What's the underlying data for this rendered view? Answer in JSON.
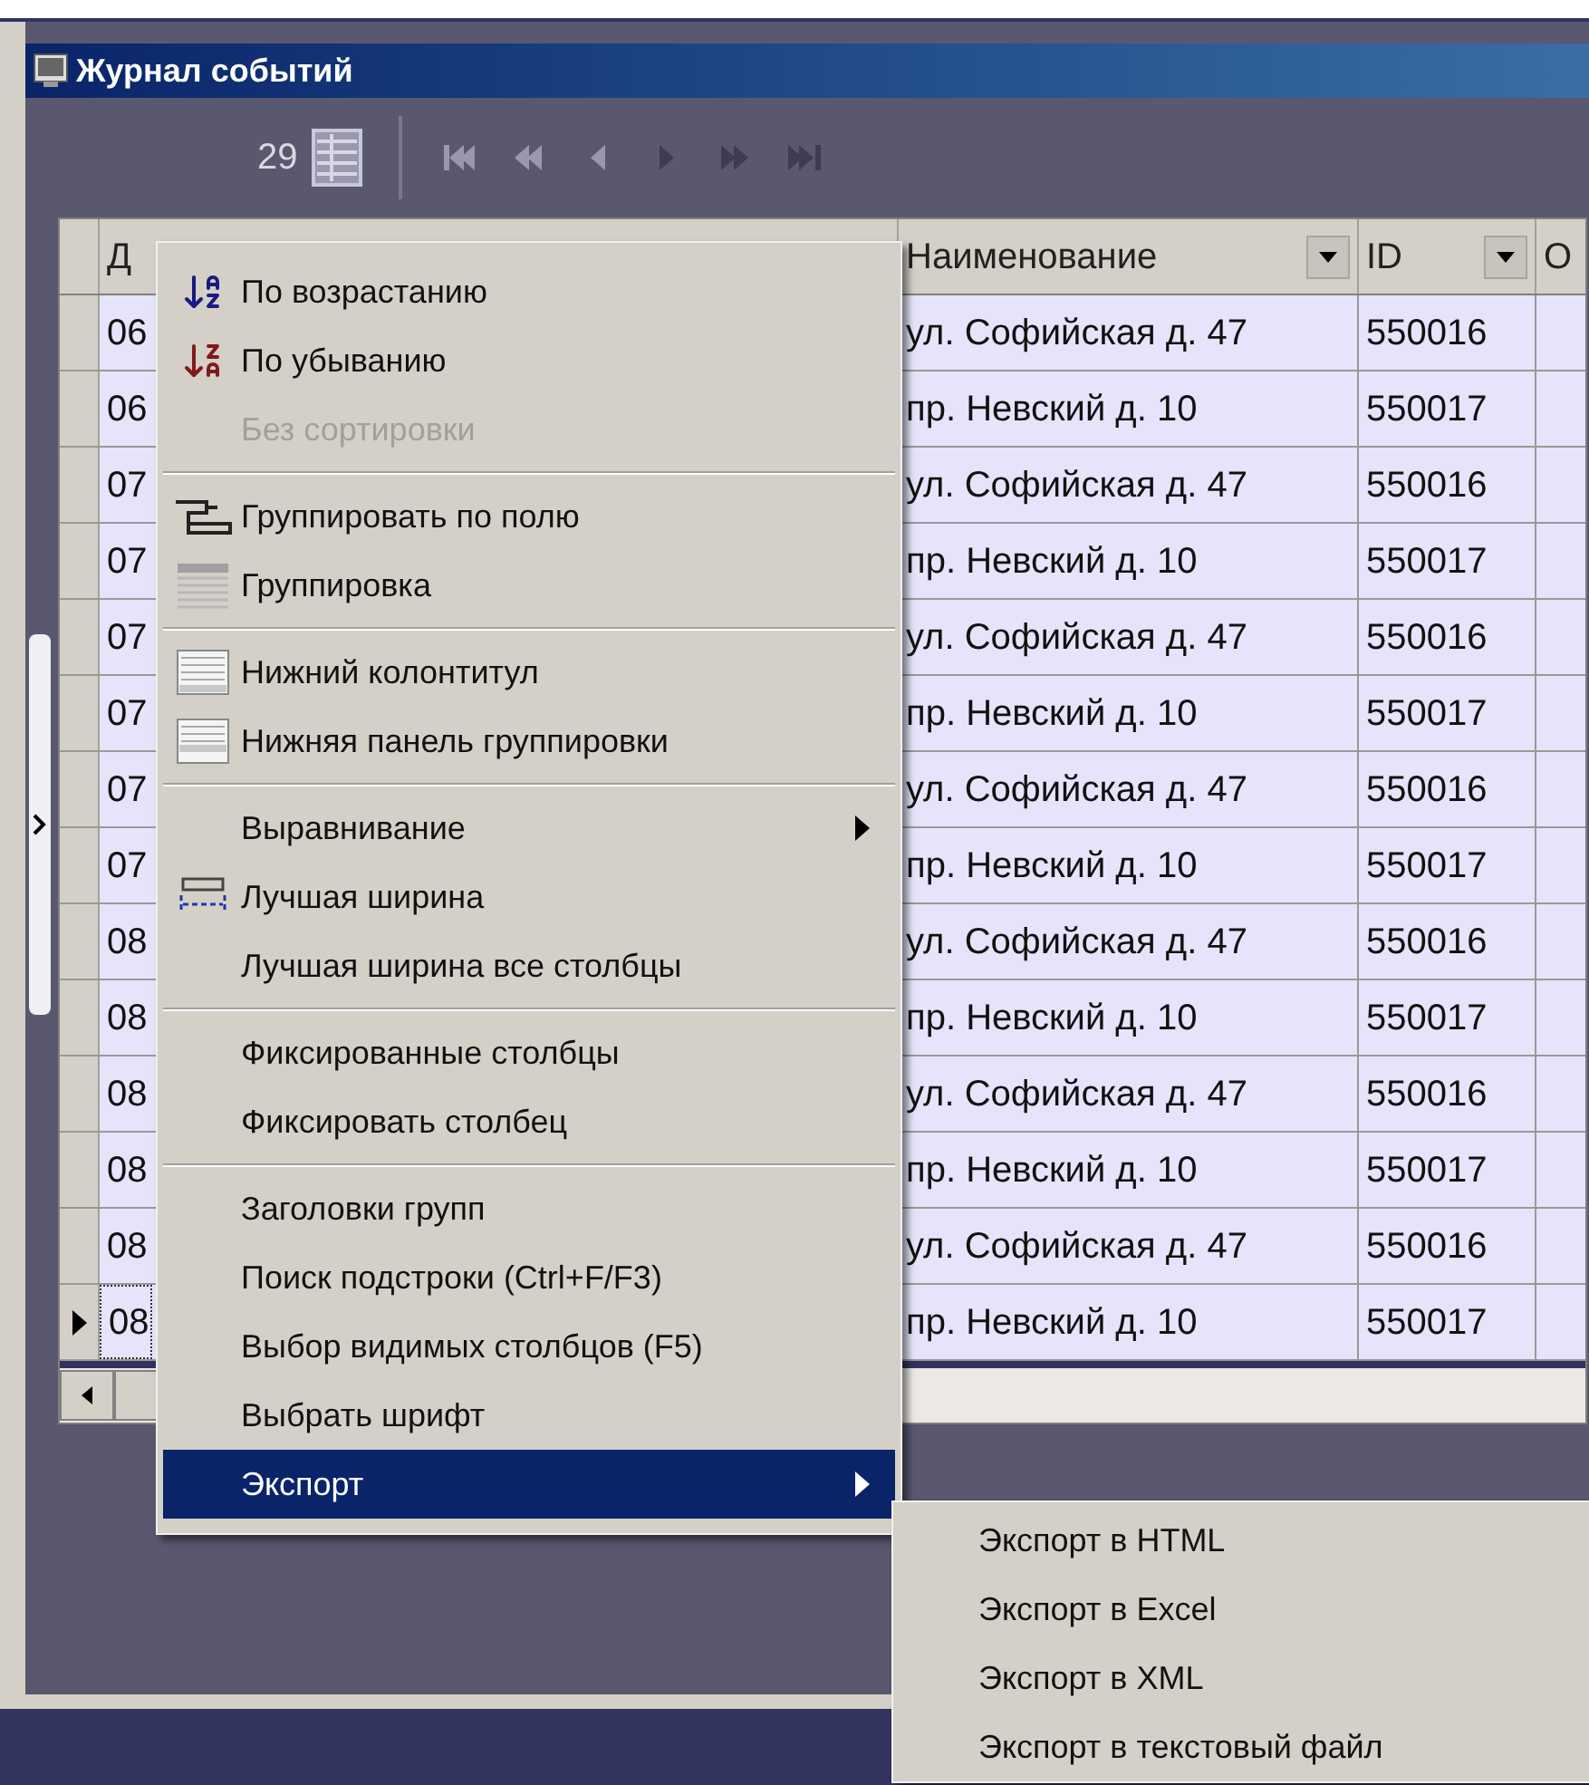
{
  "window": {
    "title": "Журнал событий"
  },
  "toolbar": {
    "count": "29",
    "nav": [
      {
        "kind": "first",
        "disabled": true
      },
      {
        "kind": "prev-page",
        "disabled": true
      },
      {
        "kind": "prev",
        "disabled": true
      },
      {
        "kind": "next",
        "disabled": false
      },
      {
        "kind": "next-page",
        "disabled": false
      },
      {
        "kind": "last",
        "disabled": false
      }
    ]
  },
  "table": {
    "columns": [
      {
        "label": "Д",
        "filter": false
      },
      {
        "label": "Наименование",
        "filter": true
      },
      {
        "label": "ID",
        "filter": true
      },
      {
        "label": "О",
        "filter": false
      }
    ],
    "rows": [
      {
        "date": "06",
        "name": "ул. Софийская д. 47",
        "id": "550016",
        "selected": false
      },
      {
        "date": "06",
        "name": "пр. Невский д. 10",
        "id": "550017",
        "selected": false
      },
      {
        "date": "07",
        "name": "ул. Софийская д. 47",
        "id": "550016",
        "selected": false
      },
      {
        "date": "07",
        "name": "пр. Невский д. 10",
        "id": "550017",
        "selected": false
      },
      {
        "date": "07",
        "name": "ул. Софийская д. 47",
        "id": "550016",
        "selected": false
      },
      {
        "date": "07",
        "name": "пр. Невский д. 10",
        "id": "550017",
        "selected": false
      },
      {
        "date": "07",
        "name": "ул. Софийская д. 47",
        "id": "550016",
        "selected": false
      },
      {
        "date": "07",
        "name": "пр. Невский д. 10",
        "id": "550017",
        "selected": false
      },
      {
        "date": "08",
        "name": "ул. Софийская д. 47",
        "id": "550016",
        "selected": false
      },
      {
        "date": "08",
        "name": "пр. Невский д. 10",
        "id": "550017",
        "selected": false
      },
      {
        "date": "08",
        "name": "ул. Софийская д. 47",
        "id": "550016",
        "selected": false
      },
      {
        "date": "08",
        "name": "пр. Невский д. 10",
        "id": "550017",
        "selected": false
      },
      {
        "date": "08",
        "name": "ул. Софийская д. 47",
        "id": "550016",
        "selected": false
      },
      {
        "date": "08",
        "name": "пр. Невский д. 10",
        "id": "550017",
        "selected": true
      }
    ]
  },
  "context_menu": {
    "items": [
      {
        "kind": "item",
        "label": "По возрастанию",
        "disabled": false,
        "submenu": false,
        "selected": false
      },
      {
        "kind": "item",
        "label": "По убыванию",
        "disabled": false,
        "submenu": false,
        "selected": false
      },
      {
        "kind": "item",
        "label": "Без сортировки",
        "disabled": true,
        "submenu": false,
        "selected": false
      },
      {
        "kind": "separator"
      },
      {
        "kind": "item",
        "label": "Группировать по полю",
        "disabled": false,
        "submenu": false,
        "selected": false
      },
      {
        "kind": "item",
        "label": "Группировка",
        "disabled": false,
        "submenu": false,
        "selected": false
      },
      {
        "kind": "separator"
      },
      {
        "kind": "item",
        "label": "Нижний колонтитул",
        "disabled": false,
        "submenu": false,
        "selected": false
      },
      {
        "kind": "item",
        "label": "Нижняя панель группировки",
        "disabled": false,
        "submenu": false,
        "selected": false
      },
      {
        "kind": "separator"
      },
      {
        "kind": "item",
        "label": "Выравнивание",
        "disabled": false,
        "submenu": true,
        "selected": false
      },
      {
        "kind": "item",
        "label": "Лучшая ширина",
        "disabled": false,
        "submenu": false,
        "selected": false
      },
      {
        "kind": "item",
        "label": "Лучшая ширина все столбцы",
        "disabled": false,
        "submenu": false,
        "selected": false
      },
      {
        "kind": "separator"
      },
      {
        "kind": "item",
        "label": "Фиксированные столбцы",
        "disabled": false,
        "submenu": false,
        "selected": false
      },
      {
        "kind": "item",
        "label": "Фиксировать столбец",
        "disabled": false,
        "submenu": false,
        "selected": false
      },
      {
        "kind": "separator"
      },
      {
        "kind": "item",
        "label": "Заголовки групп",
        "disabled": false,
        "submenu": false,
        "selected": false
      },
      {
        "kind": "item",
        "label": "Поиск подстроки (Ctrl+F/F3)",
        "disabled": false,
        "submenu": false,
        "selected": false
      },
      {
        "kind": "item",
        "label": "Выбор видимых столбцов (F5)",
        "disabled": false,
        "submenu": false,
        "selected": false
      },
      {
        "kind": "item",
        "label": "Выбрать шрифт",
        "disabled": false,
        "submenu": false,
        "selected": false
      },
      {
        "kind": "item",
        "label": "Экспорт",
        "disabled": false,
        "submenu": true,
        "selected": true
      }
    ]
  },
  "submenu": {
    "items": [
      {
        "label": "Экспорт в HTML"
      },
      {
        "label": "Экспорт в Excel"
      },
      {
        "label": "Экспорт в XML"
      },
      {
        "label": "Экспорт в текстовый файл"
      }
    ]
  }
}
